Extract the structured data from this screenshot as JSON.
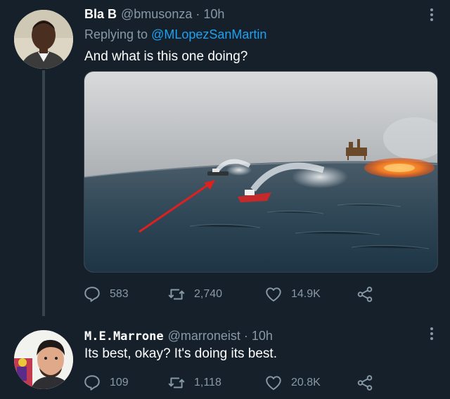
{
  "tweets": [
    {
      "author": {
        "name": "Bla B",
        "handle": "@bmusonza"
      },
      "time": "10h",
      "replying_prefix": "Replying to ",
      "replying_to": "@MLopezSanMartin",
      "text": "And what is this one doing?",
      "stats": {
        "replies": "583",
        "retweets": "2,740",
        "likes": "14.9K"
      },
      "icons": {
        "avatar": "user-avatar",
        "more": "more-icon",
        "reply": "reply-icon",
        "retweet": "retweet-icon",
        "like": "heart-icon",
        "share": "share-icon"
      }
    },
    {
      "author": {
        "name": "M.E.Marrone",
        "handle": "@marroneist"
      },
      "time": "10h",
      "text": "Its best, okay? It's doing its best.",
      "stats": {
        "replies": "109",
        "retweets": "1,118",
        "likes": "20.8K"
      }
    }
  ],
  "separator": "·",
  "colors": {
    "background": "#15202b",
    "secondary_text": "#8899a6",
    "link": "#1da1f2",
    "divider": "#38444d"
  }
}
